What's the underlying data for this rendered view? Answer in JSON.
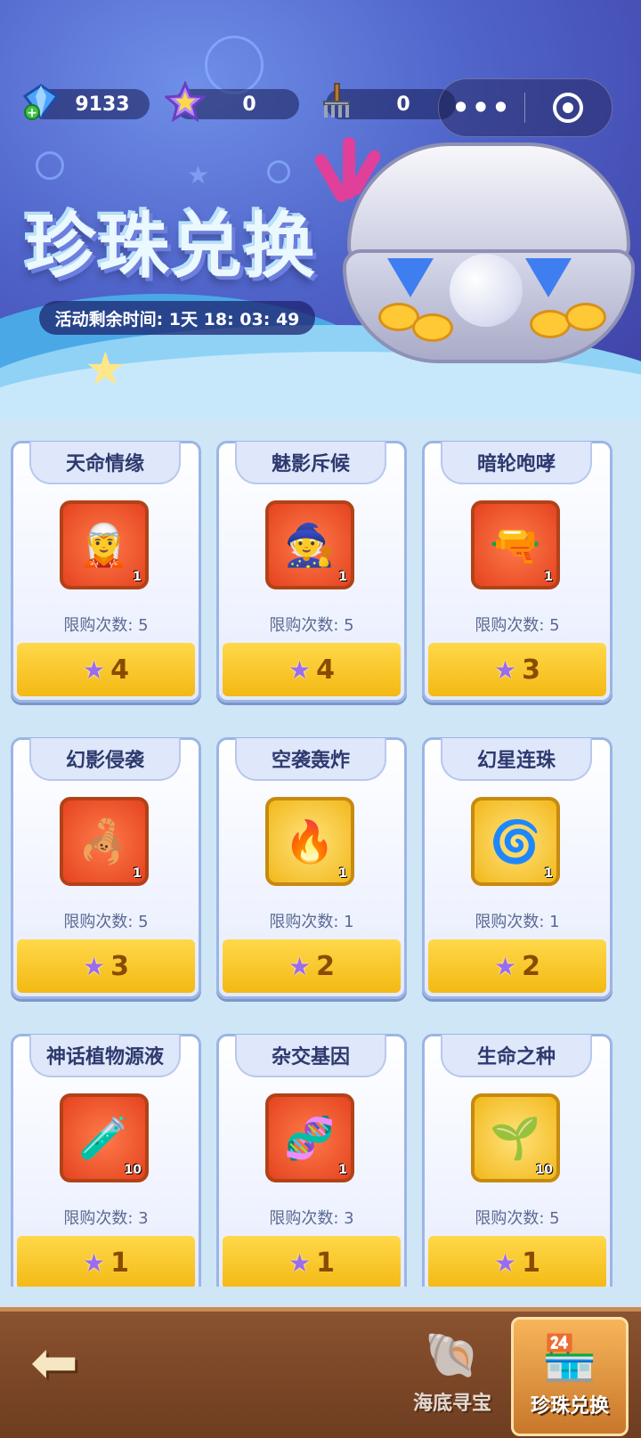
{
  "resources": [
    {
      "icon": "diamond-plus-icon",
      "value": "9133"
    },
    {
      "icon": "star-coin-icon",
      "value": "0"
    },
    {
      "icon": "rake-icon",
      "value": "0"
    }
  ],
  "capsule": {
    "more": "•••"
  },
  "banner": {
    "title": "珍珠兑换",
    "timer": "活动剩余时间: 1天 18: 03: 49"
  },
  "items": [
    {
      "name": "天命情缘",
      "limit": "限购次数: 5",
      "price": "4",
      "qty": "1",
      "frame": "red",
      "icon": "warrior-girl-icon"
    },
    {
      "name": "魅影斥候",
      "limit": "限购次数: 5",
      "price": "4",
      "qty": "1",
      "frame": "red",
      "icon": "purple-scout-icon"
    },
    {
      "name": "暗轮咆哮",
      "limit": "限购次数: 5",
      "price": "3",
      "qty": "1",
      "frame": "red",
      "icon": "flame-cannon-icon"
    },
    {
      "name": "幻影侵袭",
      "limit": "限购次数: 5",
      "price": "3",
      "qty": "1",
      "frame": "red",
      "icon": "phantom-blaster-icon"
    },
    {
      "name": "空袭轰炸",
      "limit": "限购次数: 1",
      "price": "2",
      "qty": "1",
      "frame": "gold",
      "icon": "airstrike-card-icon"
    },
    {
      "name": "幻星连珠",
      "limit": "限购次数: 1",
      "price": "2",
      "qty": "1",
      "frame": "gold",
      "icon": "star-chain-card-icon"
    },
    {
      "name": "神话植物源液",
      "limit": "限购次数: 3",
      "price": "1",
      "qty": "10",
      "frame": "red",
      "icon": "potion-flask-icon"
    },
    {
      "name": "杂交基因",
      "limit": "限购次数: 3",
      "price": "1",
      "qty": "1",
      "frame": "red",
      "icon": "gene-tube-icon"
    },
    {
      "name": "生命之种",
      "limit": "限购次数: 5",
      "price": "1",
      "qty": "10",
      "frame": "gold",
      "icon": "golden-seed-icon"
    }
  ],
  "bottom": {
    "back": "back-arrow-icon",
    "tabs": [
      {
        "label": "海底寻宝",
        "icon": "clam-shell-icon"
      },
      {
        "label": "珍珠兑换",
        "icon": "shop-stall-icon"
      }
    ]
  },
  "colors": {
    "price_bg": "#f3b913",
    "card_border": "#9cb5e6",
    "bottom_bar": "#6e3d20"
  }
}
